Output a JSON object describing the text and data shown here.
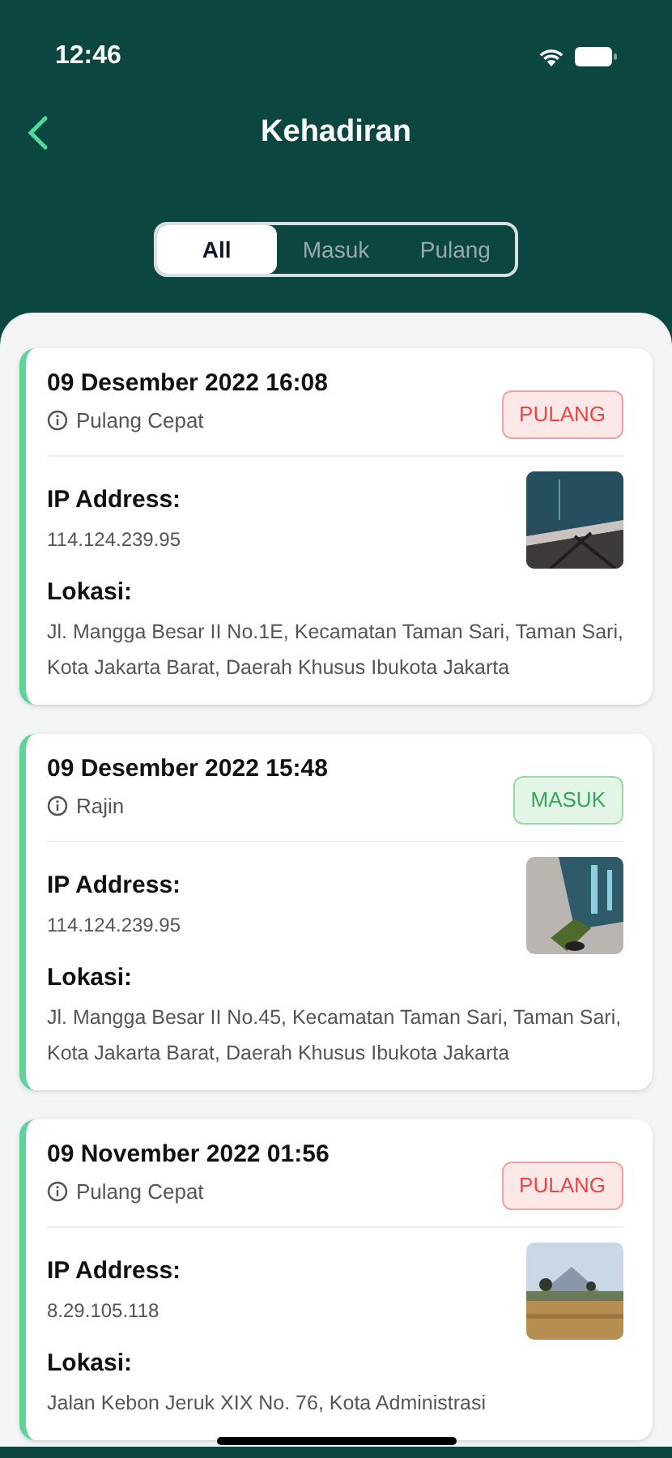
{
  "status_bar": {
    "time": "12:46"
  },
  "header": {
    "title": "Kehadiran"
  },
  "tabs": [
    {
      "label": "All",
      "selected": true
    },
    {
      "label": "Masuk",
      "selected": false
    },
    {
      "label": "Pulang",
      "selected": false
    }
  ],
  "records": [
    {
      "datetime": "09 Desember 2022 16:08",
      "note": "Pulang Cepat",
      "status": {
        "kind": "pulang",
        "label": "PULANG"
      },
      "ip_label": "IP Address:",
      "ip": "114.124.239.95",
      "location_label": "Lokasi:",
      "location": "Jl. Mangga Besar II No.1E, Kecamatan Taman Sari, Taman Sari, Kota Jakarta Barat, Daerah Khusus Ibukota Jakarta"
    },
    {
      "datetime": "09 Desember 2022 15:48",
      "note": "Rajin",
      "status": {
        "kind": "masuk",
        "label": "MASUK"
      },
      "ip_label": "IP Address:",
      "ip": "114.124.239.95",
      "location_label": "Lokasi:",
      "location": "Jl. Mangga Besar II No.45, Kecamatan Taman Sari, Taman Sari, Kota Jakarta Barat, Daerah Khusus Ibukota Jakarta"
    },
    {
      "datetime": "09 November 2022 01:56",
      "note": "Pulang Cepat",
      "status": {
        "kind": "pulang",
        "label": "PULANG"
      },
      "ip_label": "IP Address:",
      "ip": "8.29.105.118",
      "location_label": "Lokasi:",
      "location": "Jalan Kebon Jeruk XIX No. 76, Kota Administrasi"
    }
  ]
}
